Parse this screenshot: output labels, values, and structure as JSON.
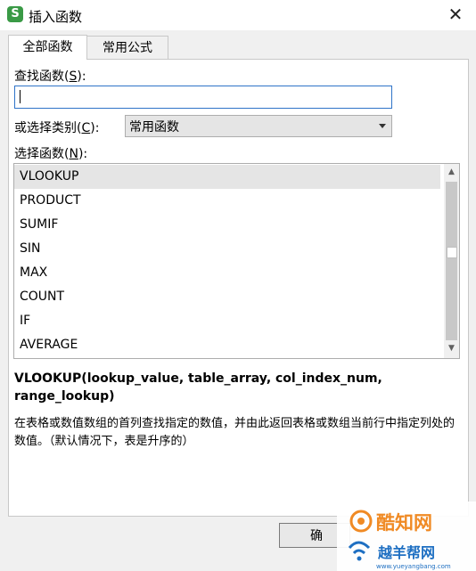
{
  "window": {
    "app_icon": "S",
    "title": "插入函数",
    "close_glyph": "✕"
  },
  "tabs": [
    {
      "label": "全部函数",
      "active": true
    },
    {
      "label": "常用公式",
      "active": false
    }
  ],
  "search": {
    "label_prefix": "查找函数(",
    "label_key": "S",
    "label_suffix": "):",
    "value": ""
  },
  "category": {
    "label_prefix": "或选择类别(",
    "label_key": "C",
    "label_suffix": "):",
    "selected": "常用函数"
  },
  "functions": {
    "label_prefix": "选择函数(",
    "label_key": "N",
    "label_suffix": "):",
    "items": [
      "VLOOKUP",
      "PRODUCT",
      "SUMIF",
      "SIN",
      "MAX",
      "COUNT",
      "IF",
      "AVERAGE"
    ],
    "selected_index": 0
  },
  "syntax": "VLOOKUP(lookup_value, table_array, col_index_num, range_lookup)",
  "description": "在表格或数值数组的首列查找指定的数值，并由此返回表格或数组当前行中指定列处的数值。（默认情况下，表是升序的）",
  "buttons": {
    "ok_label": "确"
  },
  "watermark": {
    "line1": "酷知网",
    "line2": "越羊帮网",
    "url": "www.yueyangbang.com"
  },
  "colors": {
    "accent_blue": "#2f73c8",
    "wps_green": "#3a9a46",
    "watermark_blue": "#1e6fc2",
    "watermark_orange": "#f08a24"
  }
}
